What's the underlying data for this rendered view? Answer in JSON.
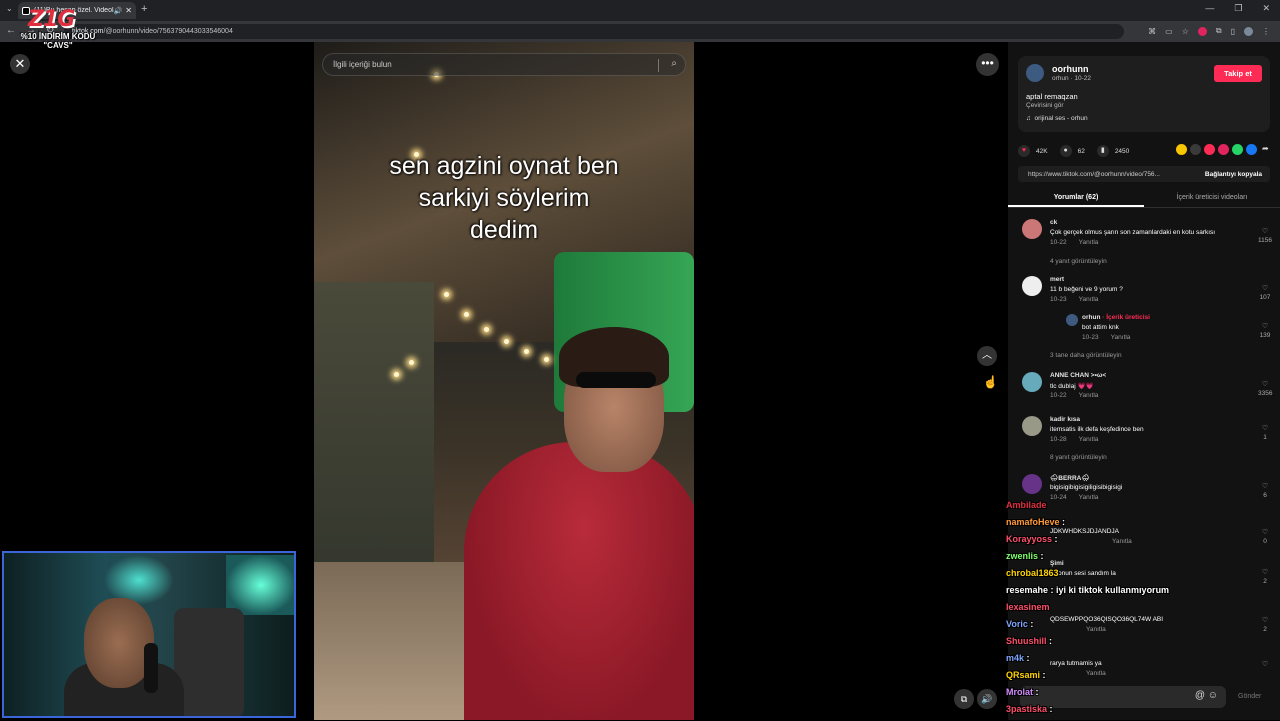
{
  "browser": {
    "tab_title": "(11)Bu hesap özel. Videolar",
    "url_host": "tiktok.com",
    "url_path": "/@oorhunn/video/7563790443033546004"
  },
  "overlay": {
    "logo_text": "Z1G",
    "promo_line1": "%10 İNDİRİM KODU",
    "promo_line2": "\"CAVS\""
  },
  "video": {
    "search_placeholder": "İlgili içeriği bulun",
    "caption_lines": [
      "sen agzini oynat ben",
      "sarkiyi söylerim",
      "dedim"
    ]
  },
  "author": {
    "username": "oorhunn",
    "meta": "orhun · 10-22",
    "follow_label": "Takip et",
    "description": "aptal remaqzan",
    "translate_label": "Çevirisini gör",
    "music": "orijinal ses - orhun"
  },
  "stats": {
    "likes": "42K",
    "comments": "62",
    "saves": "2450"
  },
  "share_colors": [
    "#f7c600",
    "#3a3a3a",
    "#fe2c55",
    "#e0245e",
    "#25d366",
    "#1877f2"
  ],
  "link": {
    "url": "https://www.tiktok.com/@oorhunn/video/756...",
    "copy_label": "Bağlantıyı kopyala"
  },
  "tabs": {
    "comments": "Yorumlar (62)",
    "creator_videos": "İçerik üreticisi videoları"
  },
  "comments": [
    {
      "user": "ck",
      "text": "Çok gerçek olmus şarın son zamanlardaki en kotu sarkısı",
      "date": "10-22",
      "reply": "Yanıtla",
      "likes": "1156",
      "more": "4 yanıt görüntüleyin"
    },
    {
      "user": "mert",
      "text": "11 b beğeni ve 9 yorum ?",
      "date": "10-23",
      "reply": "Yanıtla",
      "likes": "107",
      "sub": {
        "user": "orhun",
        "badge": "· İçerik üreticisi",
        "text": "bot attim knk",
        "date": "10-23",
        "reply": "Yanıtla",
        "likes": "139"
      },
      "more": "3 tane daha görüntüleyin"
    },
    {
      "user": "ANNE CHAN >•ω<",
      "text": "tlc dublaj 💗💗",
      "date": "10-22",
      "reply": "Yanıtla",
      "likes": "3356"
    },
    {
      "user": "kadir kısa",
      "text": "itemsatis ilk defa keşfedince ben",
      "date": "10-28",
      "reply": "Yanıtla",
      "likes": "1",
      "more": "8 yanıt görüntüleyin"
    },
    {
      "user": "🌧BERRA🌧",
      "text": "bigisigibigisigiligisibigisigi",
      "date": "10-24",
      "reply": "Yanıtla",
      "likes": "6"
    },
    {
      "user": "",
      "text": "JDKWHDKSJDJANDJA",
      "date": "",
      "reply": "Yanıtla",
      "likes": "0"
    },
    {
      "user": "Şimi",
      "text": "onun sesi sandım la",
      "date": "",
      "reply": "",
      "likes": "2"
    },
    {
      "user": "",
      "text": "QDSEWPPQO36QISQO36QL74W ABI",
      "date": "",
      "reply": "Yanıtla",
      "likes": "2"
    },
    {
      "user": "",
      "text": "rarya tutmamis ya",
      "date": "",
      "reply": "Yanıtla",
      "likes": ""
    }
  ],
  "chat": [
    {
      "user": "Ambilade",
      "color": "#e03040",
      "msg": ""
    },
    {
      "user": "namafoHeve",
      "color": "#ff9a3c",
      "msg": ""
    },
    {
      "user": "Korayyoss",
      "color": "#ff4f6a",
      "msg": ""
    },
    {
      "user": "zwenlis",
      "color": "#7dff6a",
      "msg": ""
    },
    {
      "user": "chrobal1863",
      "color": "#ffd400",
      "msg": ""
    },
    {
      "user": "resemahe",
      "color": "#ffffff",
      "msg": "iyi ki tiktok kullanmıyorum"
    },
    {
      "user": "lexasinem",
      "color": "#ff4f6a",
      "msg": ""
    },
    {
      "user": "Voric",
      "color": "#7fa7ff",
      "msg": ""
    },
    {
      "user": "Shuushill",
      "color": "#ff4f6a",
      "msg": ""
    },
    {
      "user": "m4k",
      "color": "#7fa7ff",
      "msg": ""
    },
    {
      "user": "QRsami",
      "color": "#ffd400",
      "msg": ""
    },
    {
      "user": "Mrolat",
      "color": "#d48cff",
      "msg": ""
    },
    {
      "user": "3pastiska",
      "color": "#ff4f6a",
      "msg": ""
    }
  ],
  "footer": {
    "send_label": "Gönder"
  }
}
